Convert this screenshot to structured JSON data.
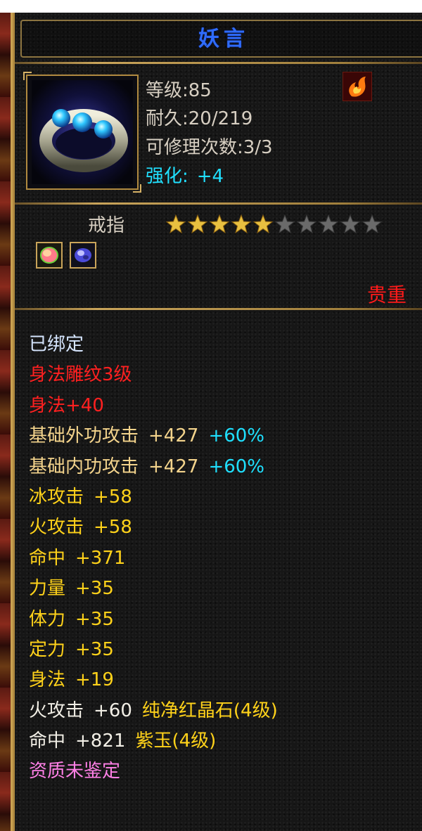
{
  "item": {
    "name": "妖言",
    "level": "等级:85",
    "durability": "耐久:20/219",
    "repairs": "可修理次数:3/3",
    "enhance_label": "强化:",
    "enhance_value": "+4",
    "type": "戒指",
    "stars_filled": 5,
    "stars_total": 10,
    "rarity": "贵重",
    "icon": "silver-ring-with-blue-gems-icon",
    "element_icon": "fire-element-icon",
    "gem_slots": [
      "red-crystal-gem-icon",
      "purple-jade-gem-icon"
    ]
  },
  "attributes": [
    {
      "parts": [
        {
          "text": "已绑定",
          "color": "#d6e6ff"
        }
      ]
    },
    {
      "parts": [
        {
          "text": "身法雕纹3级",
          "color": "#ff2020"
        }
      ]
    },
    {
      "parts": [
        {
          "text": "身法+40",
          "color": "#ff2020"
        }
      ]
    },
    {
      "parts": [
        {
          "text": "基础外功攻击",
          "color": "#f4d48c"
        },
        {
          "text": "+427",
          "color": "#f4d48c"
        },
        {
          "text": "+60%",
          "color": "#1fe0ff"
        }
      ]
    },
    {
      "parts": [
        {
          "text": "基础内功攻击",
          "color": "#f4d48c"
        },
        {
          "text": "+427",
          "color": "#f4d48c"
        },
        {
          "text": "+60%",
          "color": "#1fe0ff"
        }
      ]
    },
    {
      "parts": [
        {
          "text": "冰攻击",
          "color": "#ffd21a"
        },
        {
          "text": "+58",
          "color": "#ffd21a"
        }
      ]
    },
    {
      "parts": [
        {
          "text": "火攻击",
          "color": "#ffd21a"
        },
        {
          "text": "+58",
          "color": "#ffd21a"
        }
      ]
    },
    {
      "parts": [
        {
          "text": "命中",
          "color": "#ffd21a"
        },
        {
          "text": "+371",
          "color": "#ffd21a"
        }
      ]
    },
    {
      "parts": [
        {
          "text": "力量",
          "color": "#ffd21a"
        },
        {
          "text": "+35",
          "color": "#ffd21a"
        }
      ]
    },
    {
      "parts": [
        {
          "text": "体力",
          "color": "#ffd21a"
        },
        {
          "text": "+35",
          "color": "#ffd21a"
        }
      ]
    },
    {
      "parts": [
        {
          "text": "定力",
          "color": "#ffd21a"
        },
        {
          "text": "+35",
          "color": "#ffd21a"
        }
      ]
    },
    {
      "parts": [
        {
          "text": "身法",
          "color": "#ffd21a"
        },
        {
          "text": "+19",
          "color": "#ffd21a"
        }
      ]
    },
    {
      "parts": [
        {
          "text": "火攻击",
          "color": "#f2efe6"
        },
        {
          "text": "+60",
          "color": "#f2efe6"
        },
        {
          "text": "纯净红晶石(4级)",
          "color": "#ffd21a"
        }
      ]
    },
    {
      "parts": [
        {
          "text": "命中",
          "color": "#f2efe6"
        },
        {
          "text": "+821",
          "color": "#f2efe6"
        },
        {
          "text": "紫玉(4级)",
          "color": "#ffd21a"
        }
      ]
    },
    {
      "parts": [
        {
          "text": "资质未鉴定",
          "color": "#ff80e6"
        }
      ]
    }
  ],
  "colors": {
    "title": "#2f6cff",
    "enhance": "#20e0ff",
    "rarity": "#ff1a1a",
    "star_filled": "#e8c040",
    "star_empty": "#6a6a6a"
  }
}
